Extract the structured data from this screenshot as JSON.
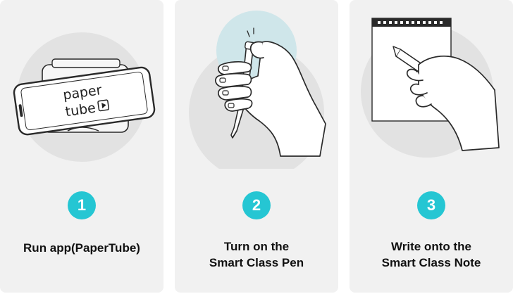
{
  "steps": [
    {
      "number": "1",
      "label_lines": [
        "Run app(PaperTube)"
      ],
      "illustration": {
        "type": "phone-on-stand",
        "screen_text": [
          "paper",
          "tube"
        ]
      }
    },
    {
      "number": "2",
      "label_lines": [
        "Turn on the",
        "Smart Class Pen"
      ],
      "illustration": {
        "type": "hand-pressing-pen"
      }
    },
    {
      "number": "3",
      "label_lines": [
        "Write onto the",
        "Smart Class Note"
      ],
      "illustration": {
        "type": "hand-writing-on-note"
      }
    }
  ],
  "colors": {
    "badge": "#25c6d3",
    "card_background": "#f1f1f1",
    "illustration_circle": "#e2e2e2",
    "highlight_circle": "#cfe6ea",
    "line": "#2a2a2a",
    "text": "#111111"
  },
  "icons": [
    "phone-icon",
    "pen-icon",
    "hand-icon",
    "notebook-icon",
    "play-icon"
  ]
}
